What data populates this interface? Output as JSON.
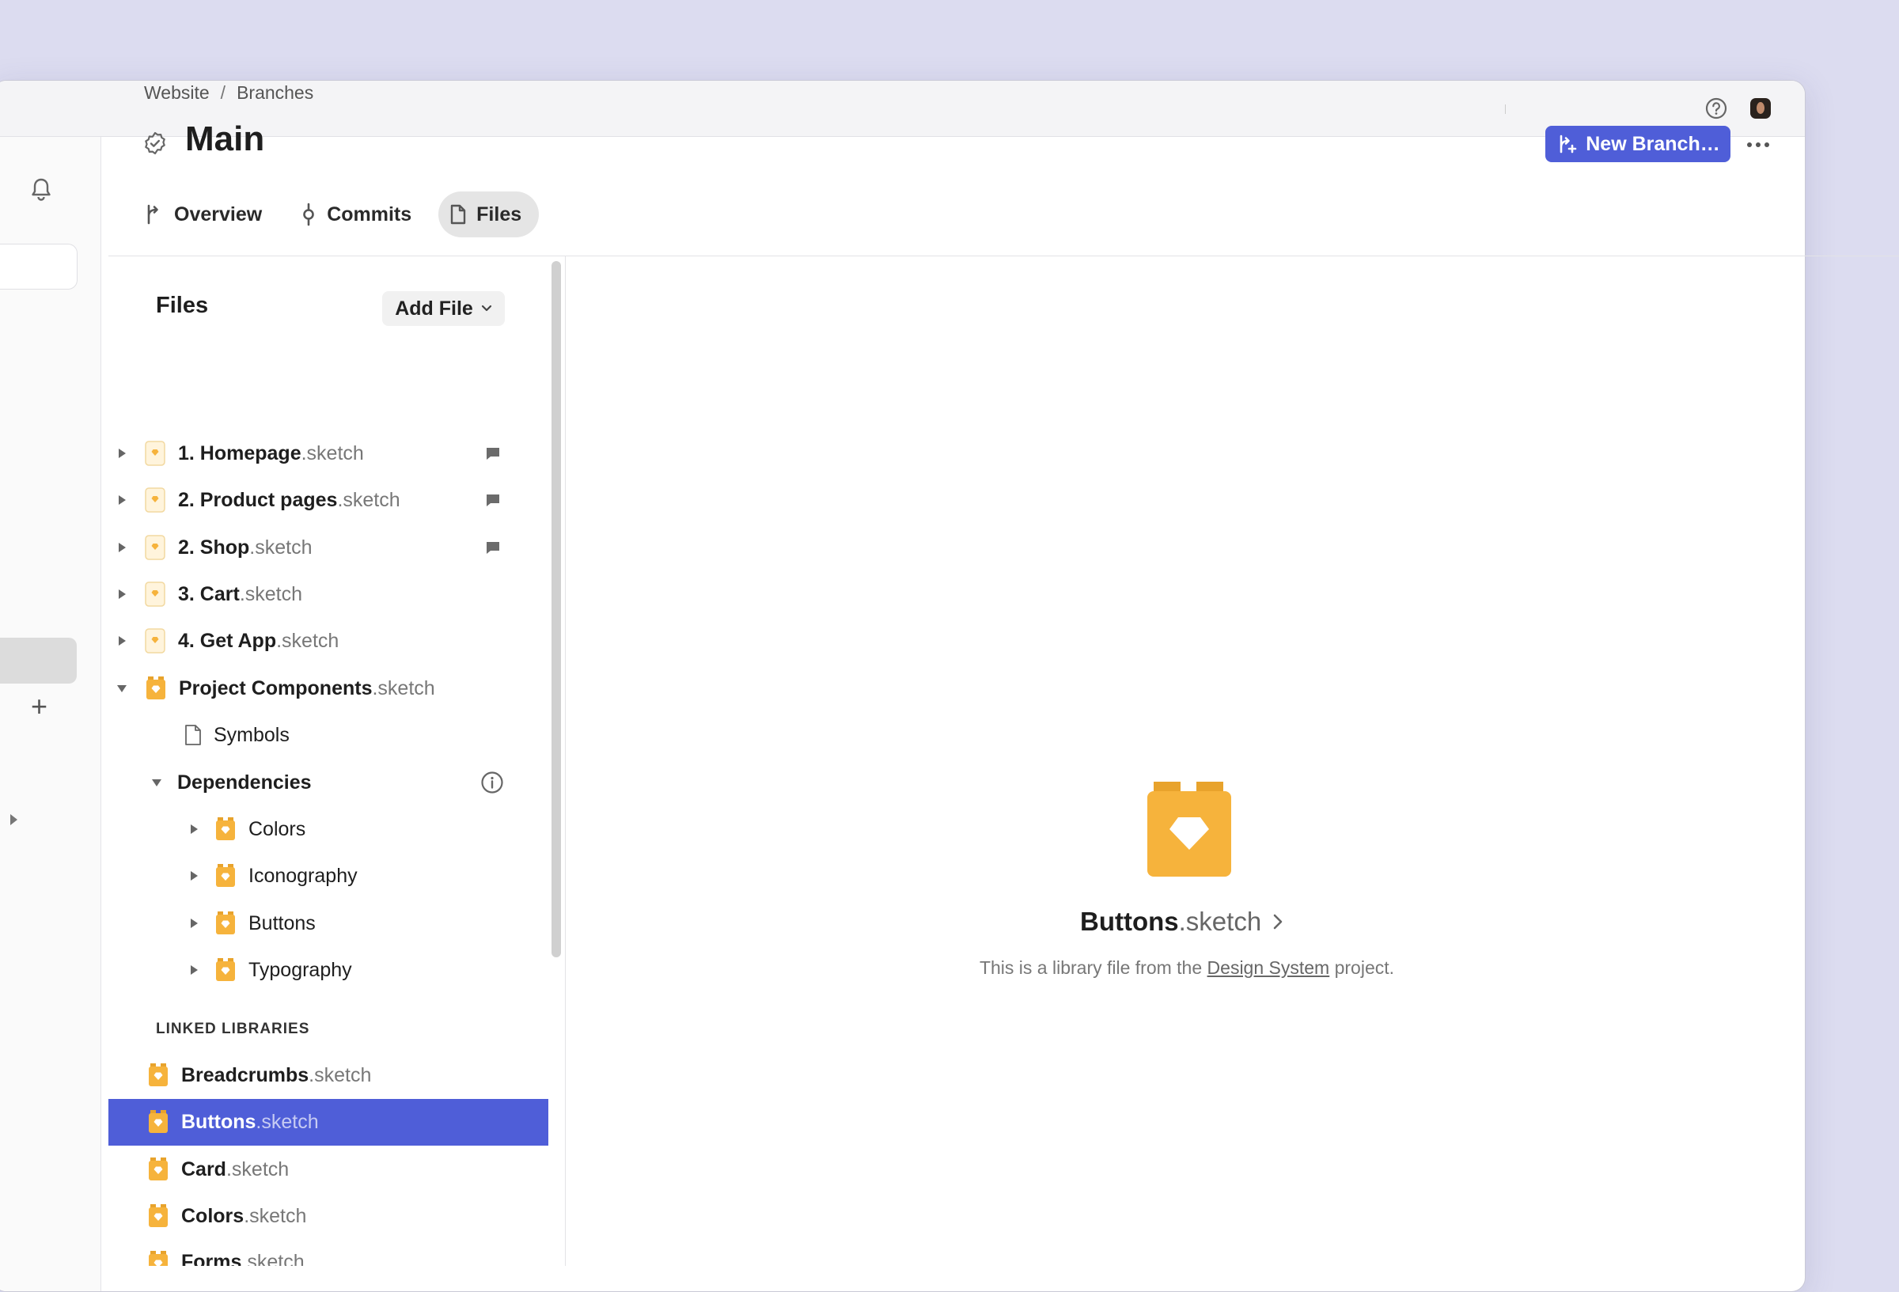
{
  "titlebar": {
    "help_icon": "help-circle-icon",
    "avatar": "user-avatar"
  },
  "sidebar": {
    "plus": "+"
  },
  "breadcrumb": {
    "items": [
      "Website",
      "Branches"
    ],
    "separator": "/"
  },
  "page": {
    "title": "Main"
  },
  "actions": {
    "new_branch": "New Branch…"
  },
  "tabs": [
    {
      "label": "Overview",
      "icon": "branch-icon"
    },
    {
      "label": "Commits",
      "icon": "commit-icon"
    },
    {
      "label": "Files",
      "icon": "file-icon",
      "active": true
    }
  ],
  "files_panel": {
    "heading": "Files",
    "add_file": "Add File",
    "documents": [
      {
        "name": "1. Homepage",
        "ext": ".sketch",
        "comments": true
      },
      {
        "name": "2. Product pages",
        "ext": ".sketch",
        "comments": true
      },
      {
        "name": "2. Shop",
        "ext": ".sketch",
        "comments": true
      },
      {
        "name": "3. Cart",
        "ext": ".sketch",
        "comments": false
      },
      {
        "name": "4. Get App",
        "ext": ".sketch",
        "comments": false
      }
    ],
    "project_components": {
      "name": "Project Components",
      "ext": ".sketch",
      "symbols": "Symbols",
      "dependencies_label": "Dependencies",
      "dependencies": [
        "Colors",
        "Iconography",
        "Buttons",
        "Typography"
      ]
    },
    "linked_label": "LINKED LIBRARIES",
    "linked_libraries": [
      {
        "name": "Breadcrumbs",
        "ext": ".sketch"
      },
      {
        "name": "Buttons",
        "ext": ".sketch",
        "selected": true
      },
      {
        "name": "Card",
        "ext": ".sketch"
      },
      {
        "name": "Colors",
        "ext": ".sketch"
      },
      {
        "name": "Forms",
        "ext": ".sketch"
      }
    ]
  },
  "preview": {
    "name": "Buttons",
    "ext": ".sketch",
    "desc_prefix": "This is a library file from the ",
    "desc_link": "Design System",
    "desc_suffix": " project."
  },
  "colors": {
    "accent": "#4f5ed8",
    "sketch_orange": "#f6b33c",
    "background": "#dcdcf0"
  }
}
